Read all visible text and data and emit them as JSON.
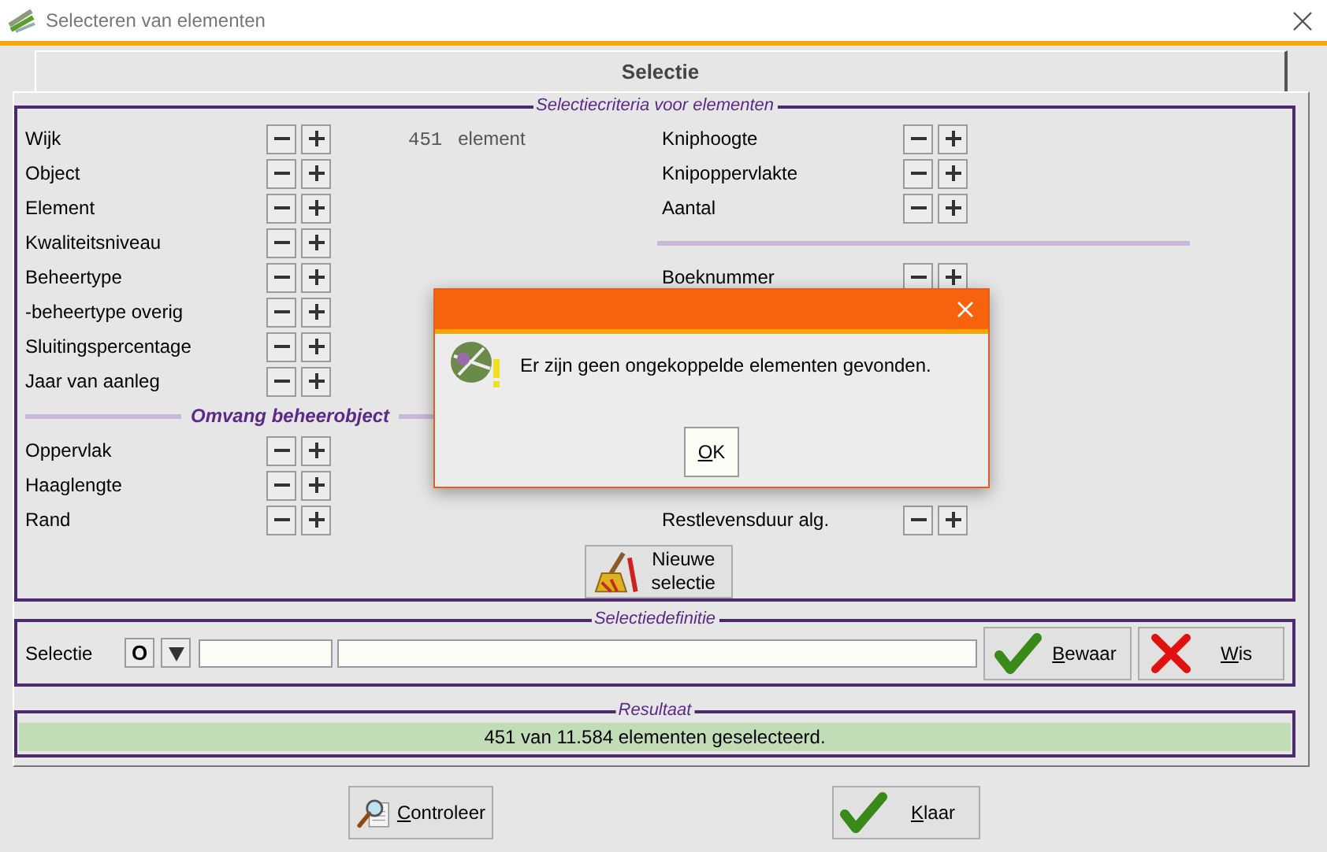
{
  "window": {
    "title": "Selecteren van elementen"
  },
  "tabs": [
    {
      "label": "Selectie",
      "selected": true
    }
  ],
  "criteria": {
    "title": "Selectiecriteria voor elementen",
    "count": {
      "value": "451",
      "unit": "element"
    },
    "left": [
      {
        "kind": "field",
        "label": "Wijk"
      },
      {
        "kind": "field",
        "label": "Object"
      },
      {
        "kind": "field",
        "label": "Element"
      },
      {
        "kind": "field",
        "label": "Kwaliteitsniveau"
      },
      {
        "kind": "field",
        "label": "Beheertype"
      },
      {
        "kind": "field",
        "label": "-beheertype overig"
      },
      {
        "kind": "field",
        "label": "Sluitingspercentage"
      },
      {
        "kind": "field",
        "label": "Jaar van aanleg"
      },
      {
        "kind": "heading",
        "label": "Omvang beheerobject"
      },
      {
        "kind": "field",
        "label": "Oppervlak"
      },
      {
        "kind": "field",
        "label": "Haaglengte"
      },
      {
        "kind": "field",
        "label": "Rand"
      }
    ],
    "right_upper": [
      {
        "kind": "field",
        "label": "Kniphoogte"
      },
      {
        "kind": "field",
        "label": "Knipoppervlakte"
      },
      {
        "kind": "field",
        "label": "Aantal"
      },
      {
        "kind": "rule"
      },
      {
        "kind": "field",
        "label": "Boeknummer"
      }
    ],
    "right_lower": [
      {
        "kind": "field",
        "label": "Restlevensduur alg."
      }
    ],
    "new_selection_button": "Nieuwe selectie"
  },
  "definition": {
    "title": "Selectiedefinitie",
    "label": "Selectie",
    "operator": "O",
    "buttons": [
      {
        "kind": "save",
        "label": "Bewaar"
      },
      {
        "kind": "delete",
        "label": "Wis"
      }
    ]
  },
  "result": {
    "title": "Resultaat",
    "text": "451 van 11.584 elementen geselecteerd."
  },
  "footer_buttons": [
    {
      "kind": "check",
      "label": "Controleer"
    },
    {
      "kind": "done",
      "label": "Klaar"
    }
  ],
  "dialog": {
    "message": "Er zijn geen ongekoppelde elementen gevonden.",
    "button": "OK"
  }
}
